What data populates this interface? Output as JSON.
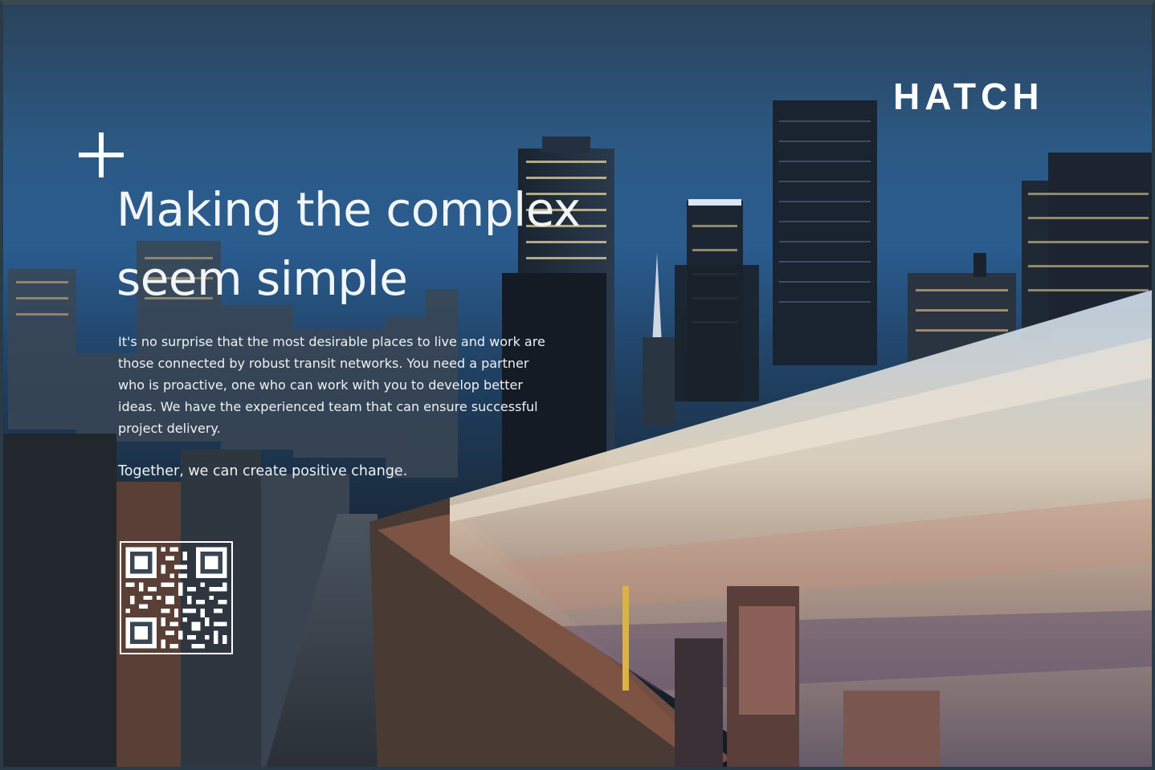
{
  "brand": {
    "logo_text": "HATCH",
    "logo_color": "#ffffff"
  },
  "headline": {
    "lines": [
      "Making the complex",
      "seem simple"
    ]
  },
  "body": {
    "lines": [
      "It's no surprise that the most desirable places to live and work are",
      "those connected by robust transit networks. You need a partner",
      "who is proactive, one who can work with you to develop better",
      "ideas. We have the experienced team that can ensure successful",
      "project delivery."
    ],
    "closing": "Together, we can create positive change."
  },
  "icons": {
    "plus": "plus-icon",
    "qr": "qr-code-icon"
  },
  "colors": {
    "sky_top": "#2a4259",
    "sky_mid": "#2a5c8f",
    "city_dark": "#141a22",
    "text": "#f2f5f8",
    "train_light": "#e8dcc8"
  }
}
